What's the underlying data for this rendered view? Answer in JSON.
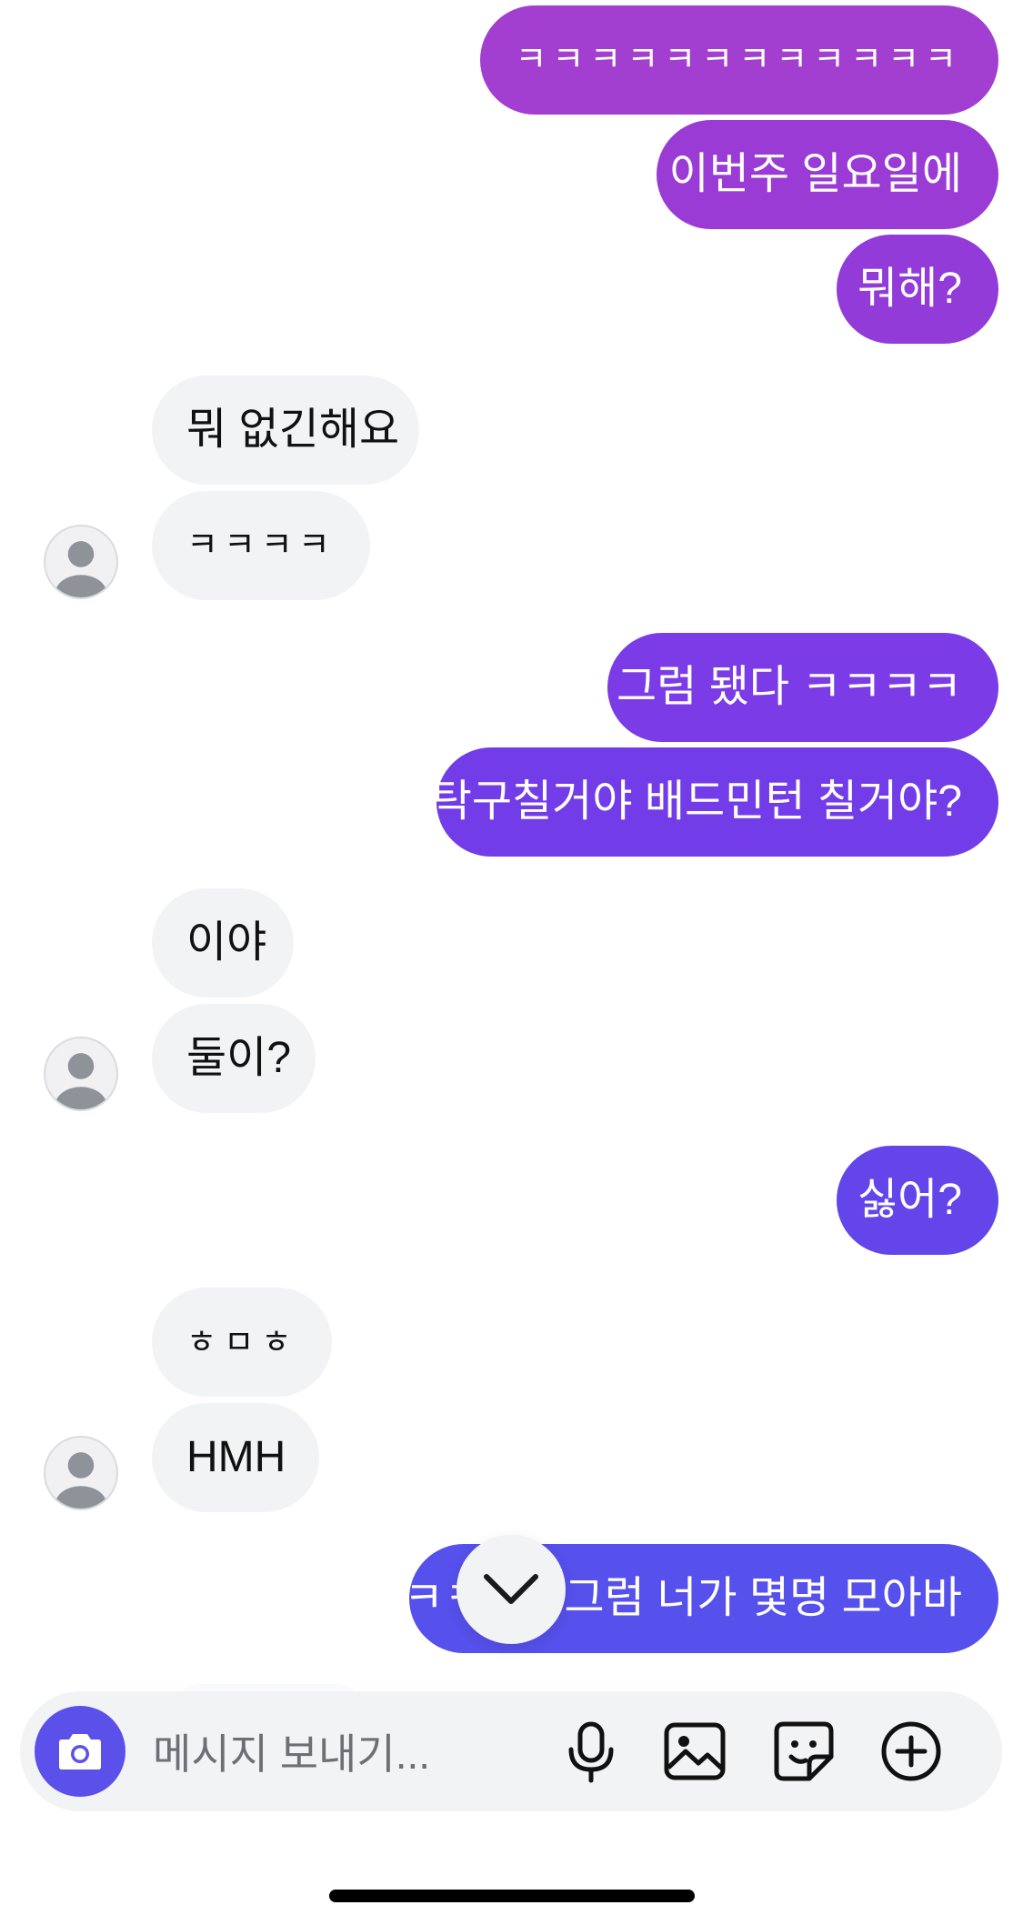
{
  "messages": [
    {
      "side": "out",
      "text": "ㅋㅋㅋㅋㅋㅋㅋㅋㅋㅋㅋㅋ",
      "color": "#a23fd1"
    },
    {
      "side": "out",
      "text": "이번주 일요일에",
      "color": "#9a3bd6"
    },
    {
      "side": "out",
      "text": "뭐해?",
      "color": "#923bd9"
    },
    {
      "side": "in",
      "text": "뭐 없긴해요"
    },
    {
      "side": "in",
      "text": "ㅋㅋㅋㅋ"
    },
    {
      "side": "out",
      "text": "그럼 됐다 ㅋㅋㅋㅋ",
      "color": "#7b3be6"
    },
    {
      "side": "out",
      "text": "탁구칠거야 배드민턴 칠거야?",
      "color": "#723de8"
    },
    {
      "side": "in",
      "text": "이야"
    },
    {
      "side": "in",
      "text": "둘이?"
    },
    {
      "side": "out",
      "text": "싫어?",
      "color": "#6445ea"
    },
    {
      "side": "in",
      "text": "ㅎㅁㅎ"
    },
    {
      "side": "in",
      "text": "HMH"
    },
    {
      "side": "out",
      "text": "ㅋㅋㅋㅋ그럼 너가 몇명 모아바",
      "color": "#5650ec"
    }
  ],
  "composer": {
    "placeholder": "메시지 보내기...",
    "icons": [
      "camera-icon",
      "microphone-icon",
      "gallery-icon",
      "sticker-icon",
      "plus-icon"
    ]
  },
  "colors": {
    "incoming_bubble": "#f2f3f5",
    "camera_button": "#5b50ea",
    "avatar_fill": "#8e9299"
  }
}
